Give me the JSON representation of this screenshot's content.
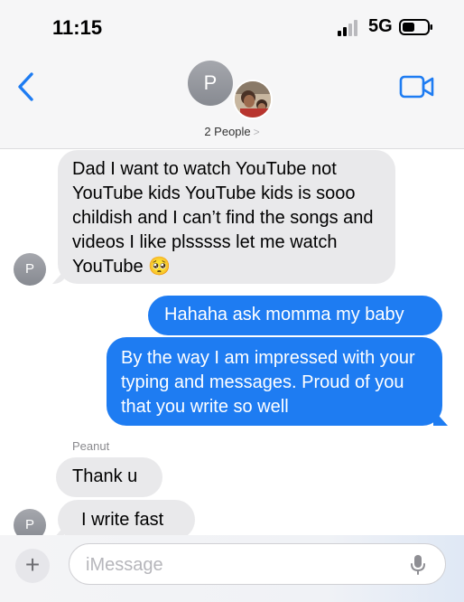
{
  "status_bar": {
    "time": "11:15",
    "network": "5G"
  },
  "header": {
    "avatar_initial": "P",
    "people_label": "2 People",
    "people_chevron": ">"
  },
  "messages": [
    {
      "text": "Dad I want to watch YouTube not YouTube kids YouTube kids is sooo childish and I can’t find the songs and videos I like  plsssss let me watch YouTube 🥺",
      "direction": "received",
      "avatar_initial": "P"
    },
    {
      "text": "Hahaha ask momma my baby",
      "direction": "sent"
    },
    {
      "text": "By the way I am impressed with your typing and messages. Proud of you that you write so well",
      "direction": "sent"
    },
    {
      "sender": "Peanut",
      "text": "Thank u",
      "direction": "received"
    },
    {
      "text": "I write fast",
      "direction": "received",
      "avatar_initial": "P"
    }
  ],
  "input_bar": {
    "plus_label": "+",
    "placeholder": "iMessage"
  },
  "icons": {
    "back": "chevron-left-icon",
    "video": "video-camera-icon",
    "mic": "microphone-icon",
    "signal": "cellular-signal-icon",
    "battery": "battery-icon"
  },
  "colors": {
    "accent": "#1e7cf2",
    "received_bubble": "#e9e9eb",
    "sent_bubble": "#1e7cf2"
  }
}
